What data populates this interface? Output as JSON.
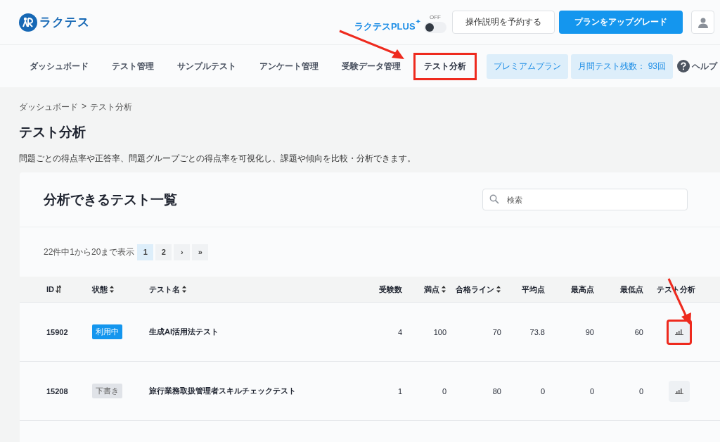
{
  "header": {
    "logo_text": "ラクテス",
    "plus": {
      "label": "ラクテスPLUS",
      "mark": "✦",
      "toggle_label": "OFF",
      "on": false
    },
    "buttons": [
      {
        "label": "操作説明を予約する",
        "kind": "outline"
      },
      {
        "label": "プランをアップグレード",
        "kind": "primary"
      }
    ]
  },
  "nav": {
    "items": [
      {
        "label": "ダッシュボード",
        "selected": false,
        "highlighted": false
      },
      {
        "label": "テスト管理",
        "selected": false,
        "highlighted": false
      },
      {
        "label": "サンプルテスト",
        "selected": false,
        "highlighted": false
      },
      {
        "label": "アンケート管理",
        "selected": false,
        "highlighted": false
      },
      {
        "label": "受験データ管理",
        "selected": false,
        "highlighted": false
      },
      {
        "label": "テスト分析",
        "selected": true,
        "highlighted": true
      }
    ],
    "badges": [
      "プレミアムプラン",
      "月間テスト残数： 93回"
    ],
    "help": "ヘルプ"
  },
  "page": {
    "breadcrumb": [
      "ダッシュボード",
      "テスト分析"
    ],
    "breadcrumb_separator": ">",
    "title": "テスト分析",
    "description": "問題ごとの得点率や正答率、問題グループごとの得点率を可視化し、課題や傾向を比較・分析できます。"
  },
  "list": {
    "title": "分析できるテスト一覧",
    "search": {
      "placeholder": "検索"
    },
    "count_text": "22件中1から20まで表示",
    "pages": [
      {
        "label": "1",
        "selected": true
      },
      {
        "label": "2",
        "selected": false
      },
      {
        "label": "›",
        "selected": false
      },
      {
        "label": "»",
        "selected": false
      }
    ],
    "columns": [
      {
        "label": "ID",
        "sortable": true,
        "sorted": true
      },
      {
        "label": "状態",
        "sortable": true,
        "sorted": false
      },
      {
        "label": "テスト名",
        "sortable": true,
        "sorted": false
      },
      {
        "label": "受験数",
        "sortable": false,
        "sorted": false
      },
      {
        "label": "満点",
        "sortable": true,
        "sorted": false
      },
      {
        "label": "合格ライン",
        "sortable": true,
        "sorted": false
      },
      {
        "label": "平均点",
        "sortable": false,
        "sorted": false
      },
      {
        "label": "最高点",
        "sortable": false,
        "sorted": false
      },
      {
        "label": "最低点",
        "sortable": false,
        "sorted": false
      },
      {
        "label": "テスト分析",
        "sortable": false,
        "sorted": false
      }
    ],
    "rows": [
      {
        "id": "15902",
        "status": "利用中",
        "active": true,
        "name": "生成AI活用法テスト",
        "takers": "4",
        "full": "100",
        "pass": "70",
        "avg": "73.8",
        "max": "90",
        "min": "60",
        "highlighted": true
      },
      {
        "id": "15208",
        "status": "下書き",
        "active": false,
        "name": "旅行業務取扱管理者スキルチェックテスト",
        "takers": "1",
        "full": "0",
        "pass": "80",
        "avg": "0",
        "max": "0",
        "min": "0",
        "highlighted": false
      }
    ]
  }
}
